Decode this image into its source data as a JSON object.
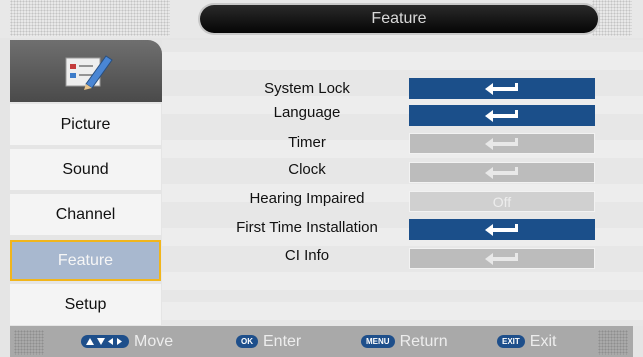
{
  "header": {
    "title": "Feature"
  },
  "sidebar": {
    "items": [
      {
        "label": "Picture"
      },
      {
        "label": "Sound"
      },
      {
        "label": "Channel"
      },
      {
        "label": "Feature"
      },
      {
        "label": "Setup"
      }
    ],
    "active": "Feature"
  },
  "options": [
    {
      "label": "System Lock",
      "state": "enter",
      "style": "blue"
    },
    {
      "label": "Language",
      "state": "enter",
      "style": "blue"
    },
    {
      "label": "Timer",
      "state": "enter",
      "style": "gray"
    },
    {
      "label": "Clock",
      "state": "enter",
      "style": "gray"
    },
    {
      "label": "Hearing Impaired",
      "value": "Off",
      "style": "disabled"
    },
    {
      "label": "First Time Installation",
      "state": "enter",
      "style": "blue"
    },
    {
      "label": "CI Info",
      "state": "enter",
      "style": "gray"
    }
  ],
  "footer": {
    "move": {
      "label": "Move",
      "icon": "arrows-icon"
    },
    "enter": {
      "chip": "OK",
      "label": "Enter"
    },
    "return": {
      "chip": "MENU",
      "label": "Return"
    },
    "exit": {
      "chip": "EXIT",
      "label": "Exit"
    }
  },
  "colors": {
    "accent_blue": "#1b4f8a",
    "active_item": "#a8b8cf",
    "active_border": "#f1b51b",
    "title_bar": "#050505"
  }
}
